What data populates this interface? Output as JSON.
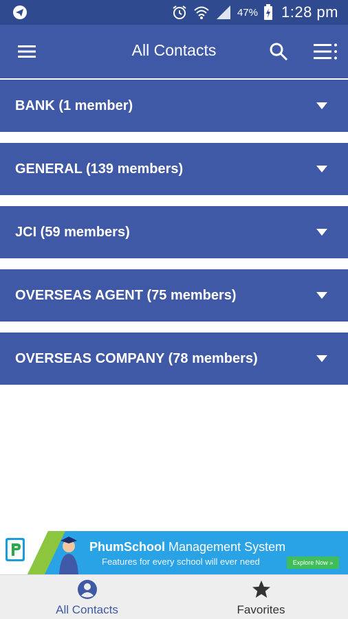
{
  "status_bar": {
    "battery_percent": "47%",
    "time": "1:28 pm",
    "icons": [
      "telegram-icon",
      "alarm-icon",
      "wifi-icon",
      "signal-icon",
      "battery-charging-icon"
    ]
  },
  "app_bar": {
    "title": "All Contacts",
    "icons": [
      "menu-icon",
      "search-icon",
      "list-menu-icon"
    ]
  },
  "groups": [
    {
      "label": "BANK (1 member)"
    },
    {
      "label": "GENERAL (139 members)"
    },
    {
      "label": "JCI (59 members)"
    },
    {
      "label": "OVERSEAS AGENT (75 members)"
    },
    {
      "label": "OVERSEAS COMPANY (78 members)"
    }
  ],
  "ad_banner": {
    "brand_bold": "PhumSchool",
    "brand_rest": " Management System",
    "tagline": "Features for every school will ever need",
    "cta": "Explore Now »"
  },
  "bottom_nav": {
    "tabs": [
      {
        "label": "All Contacts",
        "icon": "person-circle-icon",
        "active": true
      },
      {
        "label": "Favorites",
        "icon": "star-icon",
        "active": false
      }
    ]
  },
  "colors": {
    "primary": "#3f59a6",
    "status_bar": "#2f4a8f",
    "banner": "#2aa3e6",
    "cta": "#3ebd5a"
  }
}
